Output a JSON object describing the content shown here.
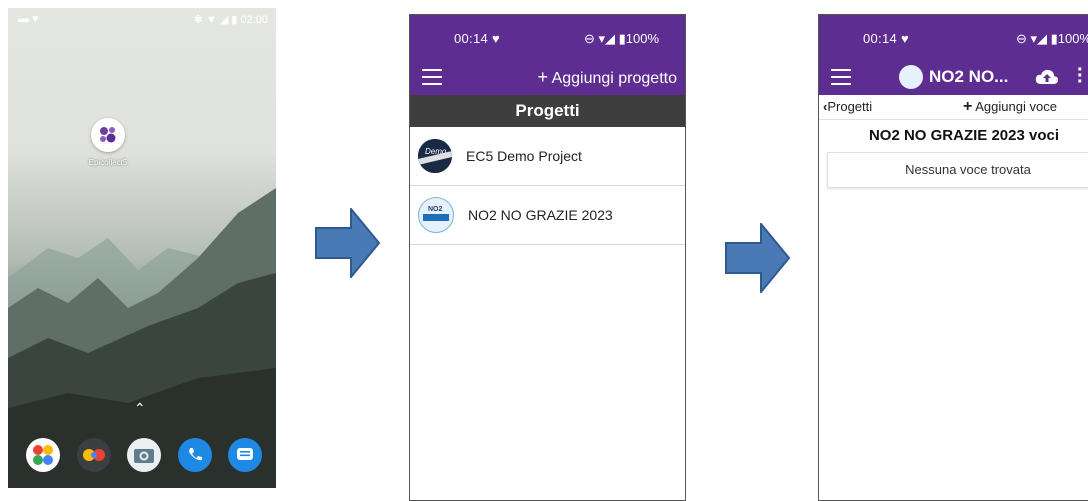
{
  "home": {
    "status_right": "02:00",
    "app_label": "Epicollect5",
    "dock": [
      "folder-icon",
      "chrome-icon",
      "camera-icon",
      "phone-icon",
      "messages-icon"
    ]
  },
  "screen2": {
    "status_time": "00:14",
    "status_battery": "100%",
    "add_project": "Aggiungi progetto",
    "title": "Progetti",
    "projects": [
      {
        "name": "EC5 Demo Project",
        "thumb_text": "Demo"
      },
      {
        "name": "NO2 NO GRAZIE 2023",
        "thumb_text": "NO2"
      }
    ]
  },
  "screen3": {
    "status_time": "00:14",
    "status_battery": "100%",
    "project_title": "NO2 NO...",
    "back_label": "Progetti",
    "add_entry": "Aggiungi voce",
    "heading": "NO2 NO GRAZIE 2023 voci",
    "empty": "Nessuna voce trovata"
  },
  "colors": {
    "primary": "#5e2d91",
    "title_bar": "#3e3e3e",
    "arrow": "#4a7ab5"
  }
}
